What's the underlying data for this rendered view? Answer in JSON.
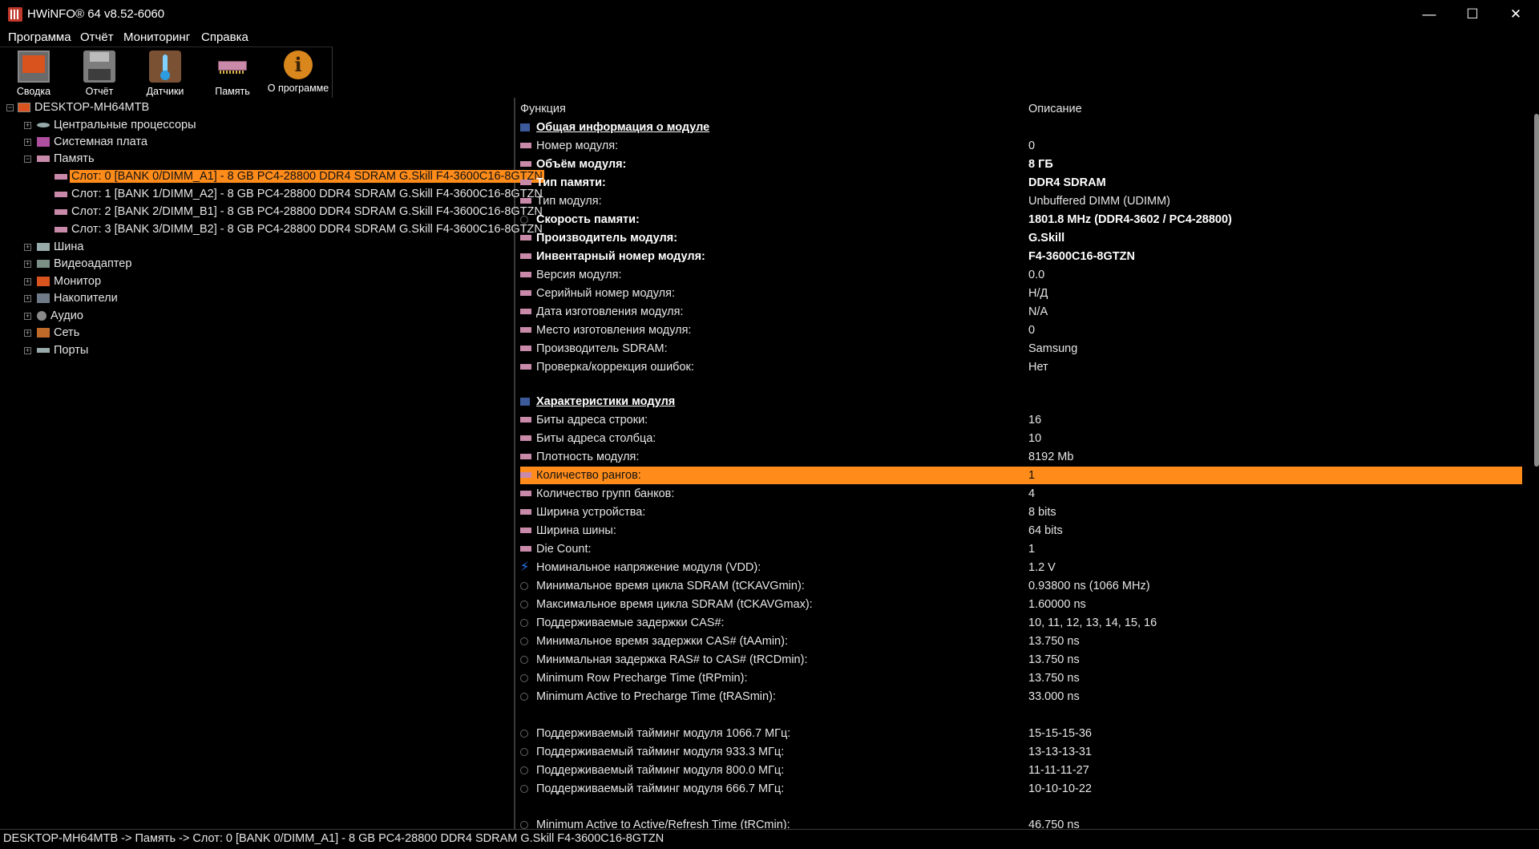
{
  "window": {
    "title": "HWiNFO® 64 v8.52-6060"
  },
  "menu": [
    "Программа",
    "Отчёт",
    "Мониторинг",
    "Справка"
  ],
  "toolbar": [
    {
      "label": "Сводка",
      "icon": "monitor-icon"
    },
    {
      "label": "Отчёт",
      "icon": "floppy-disk-icon"
    },
    {
      "label": "Датчики",
      "icon": "thermometer-icon"
    },
    {
      "label": "Память",
      "icon": "ram-icon"
    },
    {
      "label": "О программе",
      "icon": "info-icon"
    }
  ],
  "tree": {
    "root": "DESKTOP-MH64MTB",
    "nodes": [
      "Центральные процессоры",
      "Системная плата",
      "Память",
      "Шина",
      "Видеоадаптер",
      "Монитор",
      "Накопители",
      "Аудио",
      "Сеть",
      "Порты"
    ],
    "slots": [
      "Слот: 0 [BANK 0/DIMM_A1] - 8 GB PC4-28800 DDR4 SDRAM G.Skill F4-3600C16-8GTZN",
      "Слот: 1 [BANK 1/DIMM_A2] - 8 GB PC4-28800 DDR4 SDRAM G.Skill F4-3600C16-8GTZN",
      "Слот: 2 [BANK 2/DIMM_B1] - 8 GB PC4-28800 DDR4 SDRAM G.Skill F4-3600C16-8GTZN",
      "Слот: 3 [BANK 3/DIMM_B2] - 8 GB PC4-28800 DDR4 SDRAM G.Skill F4-3600C16-8GTZN"
    ]
  },
  "details": {
    "col_function": "Функция",
    "col_description": "Описание",
    "rows": [
      {
        "f": "Общая информация о модуле",
        "v": ""
      },
      {
        "f": "Номер модуля:",
        "v": "0"
      },
      {
        "f": "Объём модуля:",
        "v": "8 ГБ"
      },
      {
        "f": "Тип памяти:",
        "v": "DDR4 SDRAM"
      },
      {
        "f": "Тип модуля:",
        "v": "Unbuffered DIMM (UDIMM)"
      },
      {
        "f": "Скорость памяти:",
        "v": "1801.8 MHz (DDR4-3602 / PC4-28800)"
      },
      {
        "f": "Производитель модуля:",
        "v": "G.Skill"
      },
      {
        "f": "Инвентарный номер модуля:",
        "v": "F4-3600C16-8GTZN"
      },
      {
        "f": "Версия модуля:",
        "v": "0.0"
      },
      {
        "f": "Серийный номер модуля:",
        "v": "Н/Д"
      },
      {
        "f": "Дата изготовления модуля:",
        "v": "N/A"
      },
      {
        "f": "Место изготовления модуля:",
        "v": "0"
      },
      {
        "f": "Производитель SDRAM:",
        "v": "Samsung"
      },
      {
        "f": "Проверка/коррекция ошибок:",
        "v": "Нет"
      },
      {
        "f": "Характеристики модуля",
        "v": ""
      },
      {
        "f": "Биты адреса строки:",
        "v": "16"
      },
      {
        "f": "Биты адреса столбца:",
        "v": "10"
      },
      {
        "f": "Плотность модуля:",
        "v": "8192 Mb"
      },
      {
        "f": "Количество рангов:",
        "v": "1"
      },
      {
        "f": "Количество групп банков:",
        "v": "4"
      },
      {
        "f": "Ширина устройства:",
        "v": "8 bits"
      },
      {
        "f": "Ширина шины:",
        "v": "64 bits"
      },
      {
        "f": "Die Count:",
        "v": "1"
      },
      {
        "f": "Номинальное напряжение модуля (VDD):",
        "v": "1.2 V"
      },
      {
        "f": "Минимальное время цикла SDRAM (tCKAVGmin):",
        "v": "0.93800 ns (1066 MHz)"
      },
      {
        "f": "Максимальное время цикла SDRAM (tCKAVGmax):",
        "v": "1.60000 ns"
      },
      {
        "f": "Поддерживаемые задержки CAS#:",
        "v": "10, 11, 12, 13, 14, 15, 16"
      },
      {
        "f": "Минимальное время задержки CAS# (tAAmin):",
        "v": "13.750 ns"
      },
      {
        "f": "Минимальная задержка RAS# to CAS# (tRCDmin):",
        "v": "13.750 ns"
      },
      {
        "f": "Minimum Row Precharge Time (tRPmin):",
        "v": "13.750 ns"
      },
      {
        "f": "Minimum Active to Precharge Time (tRASmin):",
        "v": "33.000 ns"
      },
      {
        "f": "Поддерживаемый тайминг модуля 1066.7 МГц:",
        "v": "15-15-15-36"
      },
      {
        "f": "Поддерживаемый тайминг модуля 933.3 МГц:",
        "v": "13-13-13-31"
      },
      {
        "f": "Поддерживаемый тайминг модуля 800.0 МГц:",
        "v": "11-11-11-27"
      },
      {
        "f": "Поддерживаемый тайминг модуля 666.7 МГц:",
        "v": "10-10-10-22"
      },
      {
        "f": "Minimum Active to Active/Refresh Time (tRCmin):",
        "v": "46.750 ns"
      }
    ]
  },
  "status": "DESKTOP-MH64MTB -> Память -> Слот: 0 [BANK 0/DIMM_A1] - 8 GB PC4-28800 DDR4 SDRAM G.Skill F4-3600C16-8GTZN",
  "colors": {
    "highlight": "#ff8c1a",
    "background": "#000000",
    "text": "#e6e6e6"
  }
}
